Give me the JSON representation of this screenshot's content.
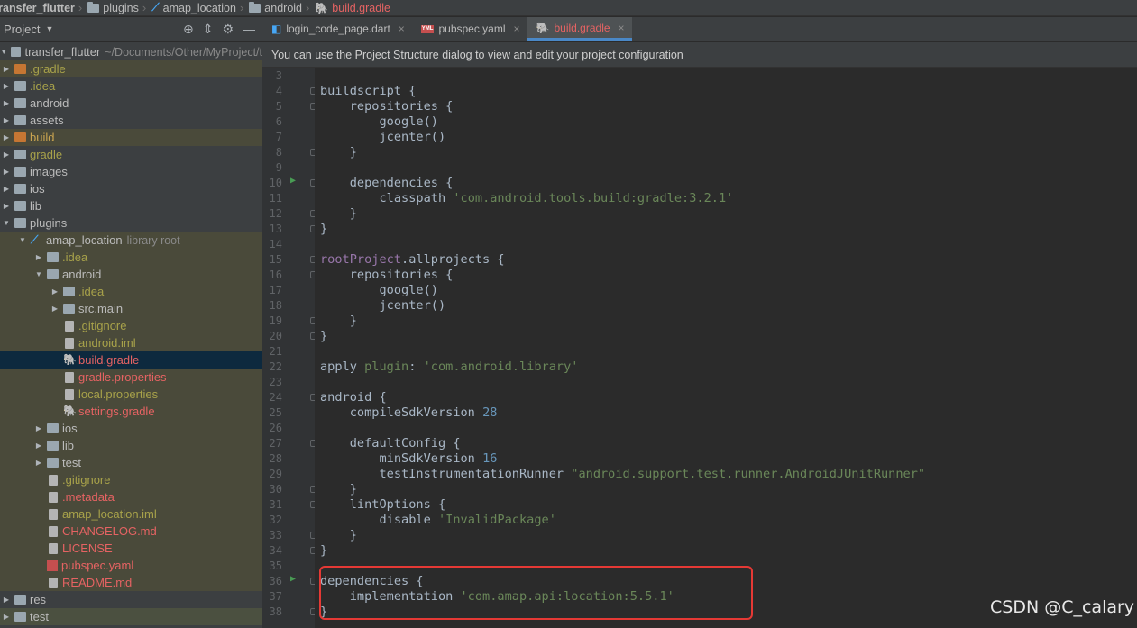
{
  "breadcrumb": [
    {
      "label": "transfer_flutter",
      "icon": "folder-icon"
    },
    {
      "label": "plugins",
      "icon": "folder-icon"
    },
    {
      "label": "amap_location",
      "icon": "flutter-icon"
    },
    {
      "label": "android",
      "icon": "folder-icon"
    },
    {
      "label": "build.gradle",
      "icon": "gradle-icon"
    }
  ],
  "project_panel": {
    "title": "Project"
  },
  "tabs": [
    {
      "label": "login_code_page.dart",
      "icon": "dart-file-icon",
      "active": false
    },
    {
      "label": "pubspec.yaml",
      "icon": "yaml-file-icon",
      "active": false
    },
    {
      "label": "build.gradle",
      "icon": "gradle-icon",
      "active": true
    }
  ],
  "banner": "You can use the Project Structure dialog to view and edit your project configuration",
  "tree": [
    {
      "label": "transfer_flutter",
      "extra": "~/Documents/Other/MyProject/t",
      "level": 0,
      "arrow": "down",
      "icon": "folder",
      "color": "default"
    },
    {
      "label": ".gradle",
      "level": 1,
      "arrow": "right",
      "icon": "folder-orange",
      "color": "olive",
      "bg": "hl"
    },
    {
      "label": ".idea",
      "level": 1,
      "arrow": "right",
      "icon": "folder",
      "color": "olive"
    },
    {
      "label": "android",
      "level": 1,
      "arrow": "right",
      "icon": "folder",
      "color": "default"
    },
    {
      "label": "assets",
      "level": 1,
      "arrow": "right",
      "icon": "folder",
      "color": "default"
    },
    {
      "label": "build",
      "level": 1,
      "arrow": "right",
      "icon": "folder-orange",
      "color": "orange",
      "bg": "hl"
    },
    {
      "label": "gradle",
      "level": 1,
      "arrow": "right",
      "icon": "folder",
      "color": "olive"
    },
    {
      "label": "images",
      "level": 1,
      "arrow": "right",
      "icon": "folder",
      "color": "default"
    },
    {
      "label": "ios",
      "level": 1,
      "arrow": "right",
      "icon": "folder",
      "color": "default"
    },
    {
      "label": "lib",
      "level": 1,
      "arrow": "right",
      "icon": "folder",
      "color": "default"
    },
    {
      "label": "plugins",
      "level": 1,
      "arrow": "down",
      "icon": "folder",
      "color": "default"
    },
    {
      "label": "amap_location",
      "extra": "library root",
      "level": 2,
      "arrow": "down",
      "icon": "flutter",
      "color": "default",
      "bg": "hl"
    },
    {
      "label": ".idea",
      "level": 3,
      "arrow": "right",
      "icon": "folder",
      "color": "olive",
      "bg": "hl"
    },
    {
      "label": "android",
      "level": 3,
      "arrow": "down",
      "icon": "folder",
      "color": "default",
      "bg": "hl"
    },
    {
      "label": ".idea",
      "level": 4,
      "arrow": "right",
      "icon": "folder",
      "color": "olive",
      "bg": "hl"
    },
    {
      "label": "src.main",
      "level": 4,
      "arrow": "right",
      "icon": "folder",
      "color": "default",
      "bg": "hl"
    },
    {
      "label": ".gitignore",
      "level": 4,
      "arrow": "none",
      "icon": "file",
      "color": "olive",
      "bg": "hl"
    },
    {
      "label": "android.iml",
      "level": 4,
      "arrow": "none",
      "icon": "file",
      "color": "olive",
      "bg": "hl"
    },
    {
      "label": "build.gradle",
      "level": 4,
      "arrow": "none",
      "icon": "gradle",
      "color": "red",
      "bg": "sel"
    },
    {
      "label": "gradle.properties",
      "level": 4,
      "arrow": "none",
      "icon": "file",
      "color": "red",
      "bg": "hl"
    },
    {
      "label": "local.properties",
      "level": 4,
      "arrow": "none",
      "icon": "file",
      "color": "olive",
      "bg": "hl"
    },
    {
      "label": "settings.gradle",
      "level": 4,
      "arrow": "none",
      "icon": "gradle",
      "color": "red",
      "bg": "hl"
    },
    {
      "label": "ios",
      "level": 3,
      "arrow": "right",
      "icon": "folder",
      "color": "default",
      "bg": "hl"
    },
    {
      "label": "lib",
      "level": 3,
      "arrow": "right",
      "icon": "folder",
      "color": "default",
      "bg": "hl"
    },
    {
      "label": "test",
      "level": 3,
      "arrow": "right",
      "icon": "folder",
      "color": "default",
      "bg": "hl"
    },
    {
      "label": ".gitignore",
      "level": 3,
      "arrow": "none",
      "icon": "file",
      "color": "olive",
      "bg": "hl"
    },
    {
      "label": ".metadata",
      "level": 3,
      "arrow": "none",
      "icon": "file",
      "color": "red",
      "bg": "hl"
    },
    {
      "label": "amap_location.iml",
      "level": 3,
      "arrow": "none",
      "icon": "file",
      "color": "olive",
      "bg": "hl"
    },
    {
      "label": "CHANGELOG.md",
      "level": 3,
      "arrow": "none",
      "icon": "file",
      "color": "red",
      "bg": "hl"
    },
    {
      "label": "LICENSE",
      "level": 3,
      "arrow": "none",
      "icon": "file",
      "color": "red",
      "bg": "hl"
    },
    {
      "label": "pubspec.yaml",
      "level": 3,
      "arrow": "none",
      "icon": "yaml",
      "color": "red",
      "bg": "hl"
    },
    {
      "label": "README.md",
      "level": 3,
      "arrow": "none",
      "icon": "file",
      "color": "red",
      "bg": "hl"
    },
    {
      "label": "res",
      "level": 1,
      "arrow": "right",
      "icon": "folder",
      "color": "default"
    },
    {
      "label": "test",
      "level": 1,
      "arrow": "right",
      "icon": "folder",
      "color": "default",
      "bg": "hl2"
    }
  ],
  "code_lines": [
    {
      "n": "3",
      "segs": []
    },
    {
      "n": "4",
      "fold": true,
      "segs": [
        [
          "buildscript {",
          "p"
        ]
      ]
    },
    {
      "n": "5",
      "fold": true,
      "segs": [
        [
          "    repositories {",
          "p"
        ]
      ]
    },
    {
      "n": "6",
      "segs": [
        [
          "        google()",
          "p"
        ]
      ]
    },
    {
      "n": "7",
      "segs": [
        [
          "        jcenter()",
          "p"
        ]
      ]
    },
    {
      "n": "8",
      "fold": true,
      "segs": [
        [
          "    }",
          "p"
        ]
      ]
    },
    {
      "n": "9",
      "segs": []
    },
    {
      "n": "10",
      "run": true,
      "fold": true,
      "segs": [
        [
          "    dependencies {",
          "p"
        ]
      ]
    },
    {
      "n": "11",
      "segs": [
        [
          "        classpath ",
          "p"
        ],
        [
          "'com.android.tools.build:gradle:3.2.1'",
          "s"
        ]
      ]
    },
    {
      "n": "12",
      "fold": true,
      "segs": [
        [
          "    }",
          "p"
        ]
      ]
    },
    {
      "n": "13",
      "fold": true,
      "segs": [
        [
          "}",
          "p"
        ]
      ]
    },
    {
      "n": "14",
      "segs": []
    },
    {
      "n": "15",
      "fold": true,
      "segs": [
        [
          "rootProject",
          "k"
        ],
        [
          ".allprojects {",
          "p"
        ]
      ]
    },
    {
      "n": "16",
      "fold": true,
      "segs": [
        [
          "    repositories {",
          "p"
        ]
      ]
    },
    {
      "n": "17",
      "segs": [
        [
          "        google()",
          "p"
        ]
      ]
    },
    {
      "n": "18",
      "segs": [
        [
          "        jcenter()",
          "p"
        ]
      ]
    },
    {
      "n": "19",
      "fold": true,
      "segs": [
        [
          "    }",
          "p"
        ]
      ]
    },
    {
      "n": "20",
      "fold": true,
      "segs": [
        [
          "}",
          "p"
        ]
      ]
    },
    {
      "n": "21",
      "segs": []
    },
    {
      "n": "22",
      "segs": [
        [
          "apply ",
          "p"
        ],
        [
          "plugin",
          "s"
        ],
        [
          ": ",
          "p"
        ],
        [
          "'com.android.library'",
          "s"
        ]
      ]
    },
    {
      "n": "23",
      "segs": []
    },
    {
      "n": "24",
      "fold": true,
      "segs": [
        [
          "android {",
          "p"
        ]
      ]
    },
    {
      "n": "25",
      "segs": [
        [
          "    compileSdkVersion ",
          "p"
        ],
        [
          "28",
          "n"
        ]
      ]
    },
    {
      "n": "26",
      "segs": []
    },
    {
      "n": "27",
      "fold": true,
      "segs": [
        [
          "    defaultConfig {",
          "p"
        ]
      ]
    },
    {
      "n": "28",
      "segs": [
        [
          "        minSdkVersion ",
          "p"
        ],
        [
          "16",
          "n"
        ]
      ]
    },
    {
      "n": "29",
      "segs": [
        [
          "        testInstrumentationRunner ",
          "p"
        ],
        [
          "\"android.support.test.runner.AndroidJUnitRunner\"",
          "s"
        ]
      ]
    },
    {
      "n": "30",
      "fold": true,
      "segs": [
        [
          "    }",
          "p"
        ]
      ]
    },
    {
      "n": "31",
      "fold": true,
      "segs": [
        [
          "    lintOptions {",
          "p"
        ]
      ]
    },
    {
      "n": "32",
      "segs": [
        [
          "        disable ",
          "p"
        ],
        [
          "'InvalidPackage'",
          "s"
        ]
      ]
    },
    {
      "n": "33",
      "fold": true,
      "segs": [
        [
          "    }",
          "p"
        ]
      ]
    },
    {
      "n": "34",
      "fold": true,
      "segs": [
        [
          "}",
          "p"
        ]
      ]
    },
    {
      "n": "35",
      "segs": []
    },
    {
      "n": "36",
      "run": true,
      "fold": true,
      "segs": [
        [
          "dependencies {",
          "p"
        ]
      ]
    },
    {
      "n": "37",
      "segs": [
        [
          "    implementation ",
          "p"
        ],
        [
          "'com.amap.api:location:5.5.1'",
          "s"
        ]
      ]
    },
    {
      "n": "38",
      "fold": true,
      "segs": [
        [
          "}",
          "p"
        ]
      ]
    }
  ],
  "watermark": "CSDN @C_calary",
  "colors": {
    "accent": "#4a88c7",
    "red_annotation": "#e53935",
    "file_modified": "#e66363",
    "file_ignored": "#a8a24a"
  }
}
